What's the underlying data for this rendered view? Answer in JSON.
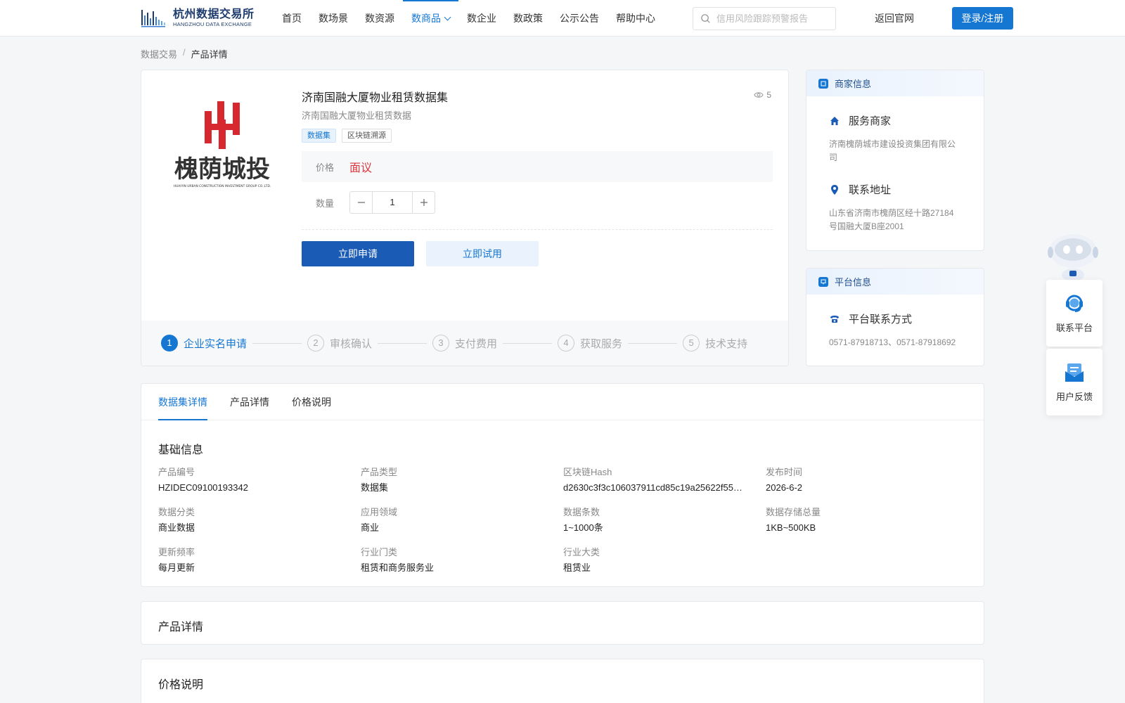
{
  "header": {
    "logo_cn": "杭州数据交易所",
    "logo_en": "HANGZHOU DATA EXCHANGE",
    "nav": [
      "首页",
      "数场景",
      "数资源",
      "数商品",
      "数企业",
      "数政策",
      "公示公告",
      "帮助中心"
    ],
    "nav_active_index": 3,
    "search_placeholder": "信用风险跟踪预警报告",
    "back_link": "返回官网",
    "login_label": "登录/注册"
  },
  "breadcrumb": [
    "数据交易",
    "产品详情"
  ],
  "product": {
    "logo_cn": "槐荫城投",
    "logo_en": "HUAIYIN URBAN CONSTRUCTION INVESTMENT GROUP CO.,LTD.",
    "title": "济南国融大厦物业租赁数据集",
    "subtitle": "济南国融大厦物业租赁数据",
    "views": "5",
    "tags": [
      "数据集",
      "区块链溯源"
    ],
    "price_label": "价格",
    "price_value": "面议",
    "qty_label": "数量",
    "qty_value": "1",
    "apply_label": "立即申请",
    "trial_label": "立即试用",
    "steps": [
      {
        "num": "1",
        "label": "企业实名申请"
      },
      {
        "num": "2",
        "label": "审核确认"
      },
      {
        "num": "3",
        "label": "支付费用"
      },
      {
        "num": "4",
        "label": "获取服务"
      },
      {
        "num": "5",
        "label": "技术支持"
      }
    ]
  },
  "merchant": {
    "header": "商家信息",
    "service_title": "服务商家",
    "service_name": "济南槐荫城市建设投资集团有限公司",
    "address_title": "联系地址",
    "address": "山东省济南市槐荫区经十路27184号国融大厦B座2001"
  },
  "platform": {
    "header": "平台信息",
    "contact_title": "平台联系方式",
    "contact": "0571-87918713、0571-87918692"
  },
  "tabs": [
    "数据集详情",
    "产品详情",
    "价格说明"
  ],
  "basic_info": {
    "title": "基础信息",
    "items": [
      {
        "k": "产品编号",
        "v": "HZIDEC09100193342"
      },
      {
        "k": "产品类型",
        "v": "数据集"
      },
      {
        "k": "区块链Hash",
        "v": "d2630c3f3c106037911cd85c19a25622f55…"
      },
      {
        "k": "发布时间",
        "v": "2026-6-2"
      },
      {
        "k": "数据分类",
        "v": "商业数据"
      },
      {
        "k": "应用领域",
        "v": "商业"
      },
      {
        "k": "数据条数",
        "v": "1~1000条"
      },
      {
        "k": "数据存储总量",
        "v": "1KB~500KB"
      },
      {
        "k": "更新频率",
        "v": "每月更新"
      },
      {
        "k": "行业门类",
        "v": "租赁和商务服务业"
      },
      {
        "k": "行业大类",
        "v": "租赁业"
      }
    ]
  },
  "product_detail_title": "产品详情",
  "price_desc_title": "价格说明",
  "float": {
    "contact_label": "联系平台",
    "feedback_label": "用户反馈"
  }
}
